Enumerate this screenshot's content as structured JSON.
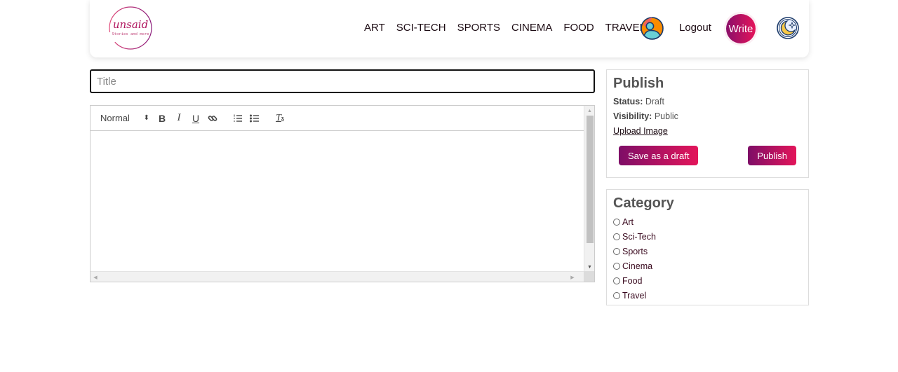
{
  "brand": {
    "name": "unsaid",
    "tagline": "Stories and more",
    "accent_start": "#8a0f6a",
    "accent_end": "#e5145a"
  },
  "nav": {
    "links": [
      "ART",
      "SCI-TECH",
      "SPORTS",
      "CINEMA",
      "FOOD",
      "TRAVEL"
    ],
    "logout_label": "Logout",
    "write_label": "Write",
    "avatar_icon": "user-avatar-icon",
    "theme_icon": "moon-star-icon"
  },
  "editor": {
    "title_placeholder": "Title",
    "title_value": "",
    "format_select": "Normal",
    "toolbar_icons": [
      "bold-icon",
      "italic-icon",
      "underline-icon",
      "link-icon",
      "ordered-list-icon",
      "bullet-list-icon",
      "clear-format-icon"
    ],
    "body": ""
  },
  "publish": {
    "heading": "Publish",
    "status_label": "Status:",
    "status_value": "Draft",
    "visibility_label": "Visibility:",
    "visibility_value": "Public",
    "upload_label": "Upload Image",
    "save_draft_label": "Save as a draft",
    "publish_label": "Publish"
  },
  "category": {
    "heading": "Category",
    "options": [
      "Art",
      "Sci-Tech",
      "Sports",
      "Cinema",
      "Food",
      "Travel"
    ],
    "selected": null
  }
}
